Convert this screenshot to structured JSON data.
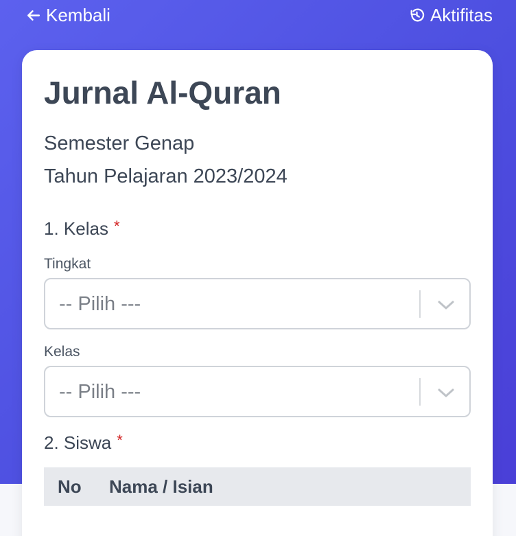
{
  "app": {
    "back_label": "Kembali",
    "activity_label": "Aktifitas",
    "accent_color": "#5c61ee",
    "icons": {
      "back": "arrow-left-icon",
      "activity": "history-icon",
      "dropdown": "chevron-down-icon"
    }
  },
  "form": {
    "title": "Jurnal Al-Quran",
    "semester": "Semester Genap",
    "academic_year": "Tahun Pelajaran 2023/2024",
    "section_1_label": "1. Kelas",
    "section_2_label": "2. Siswa",
    "required_marker": "*",
    "tingkat_label": "Tingkat",
    "tingkat_value": "-- Pilih ---",
    "kelas_label": "Kelas",
    "kelas_value": "-- Pilih ---"
  },
  "table": {
    "headers": [
      "No",
      "Nama / Isian"
    ]
  }
}
